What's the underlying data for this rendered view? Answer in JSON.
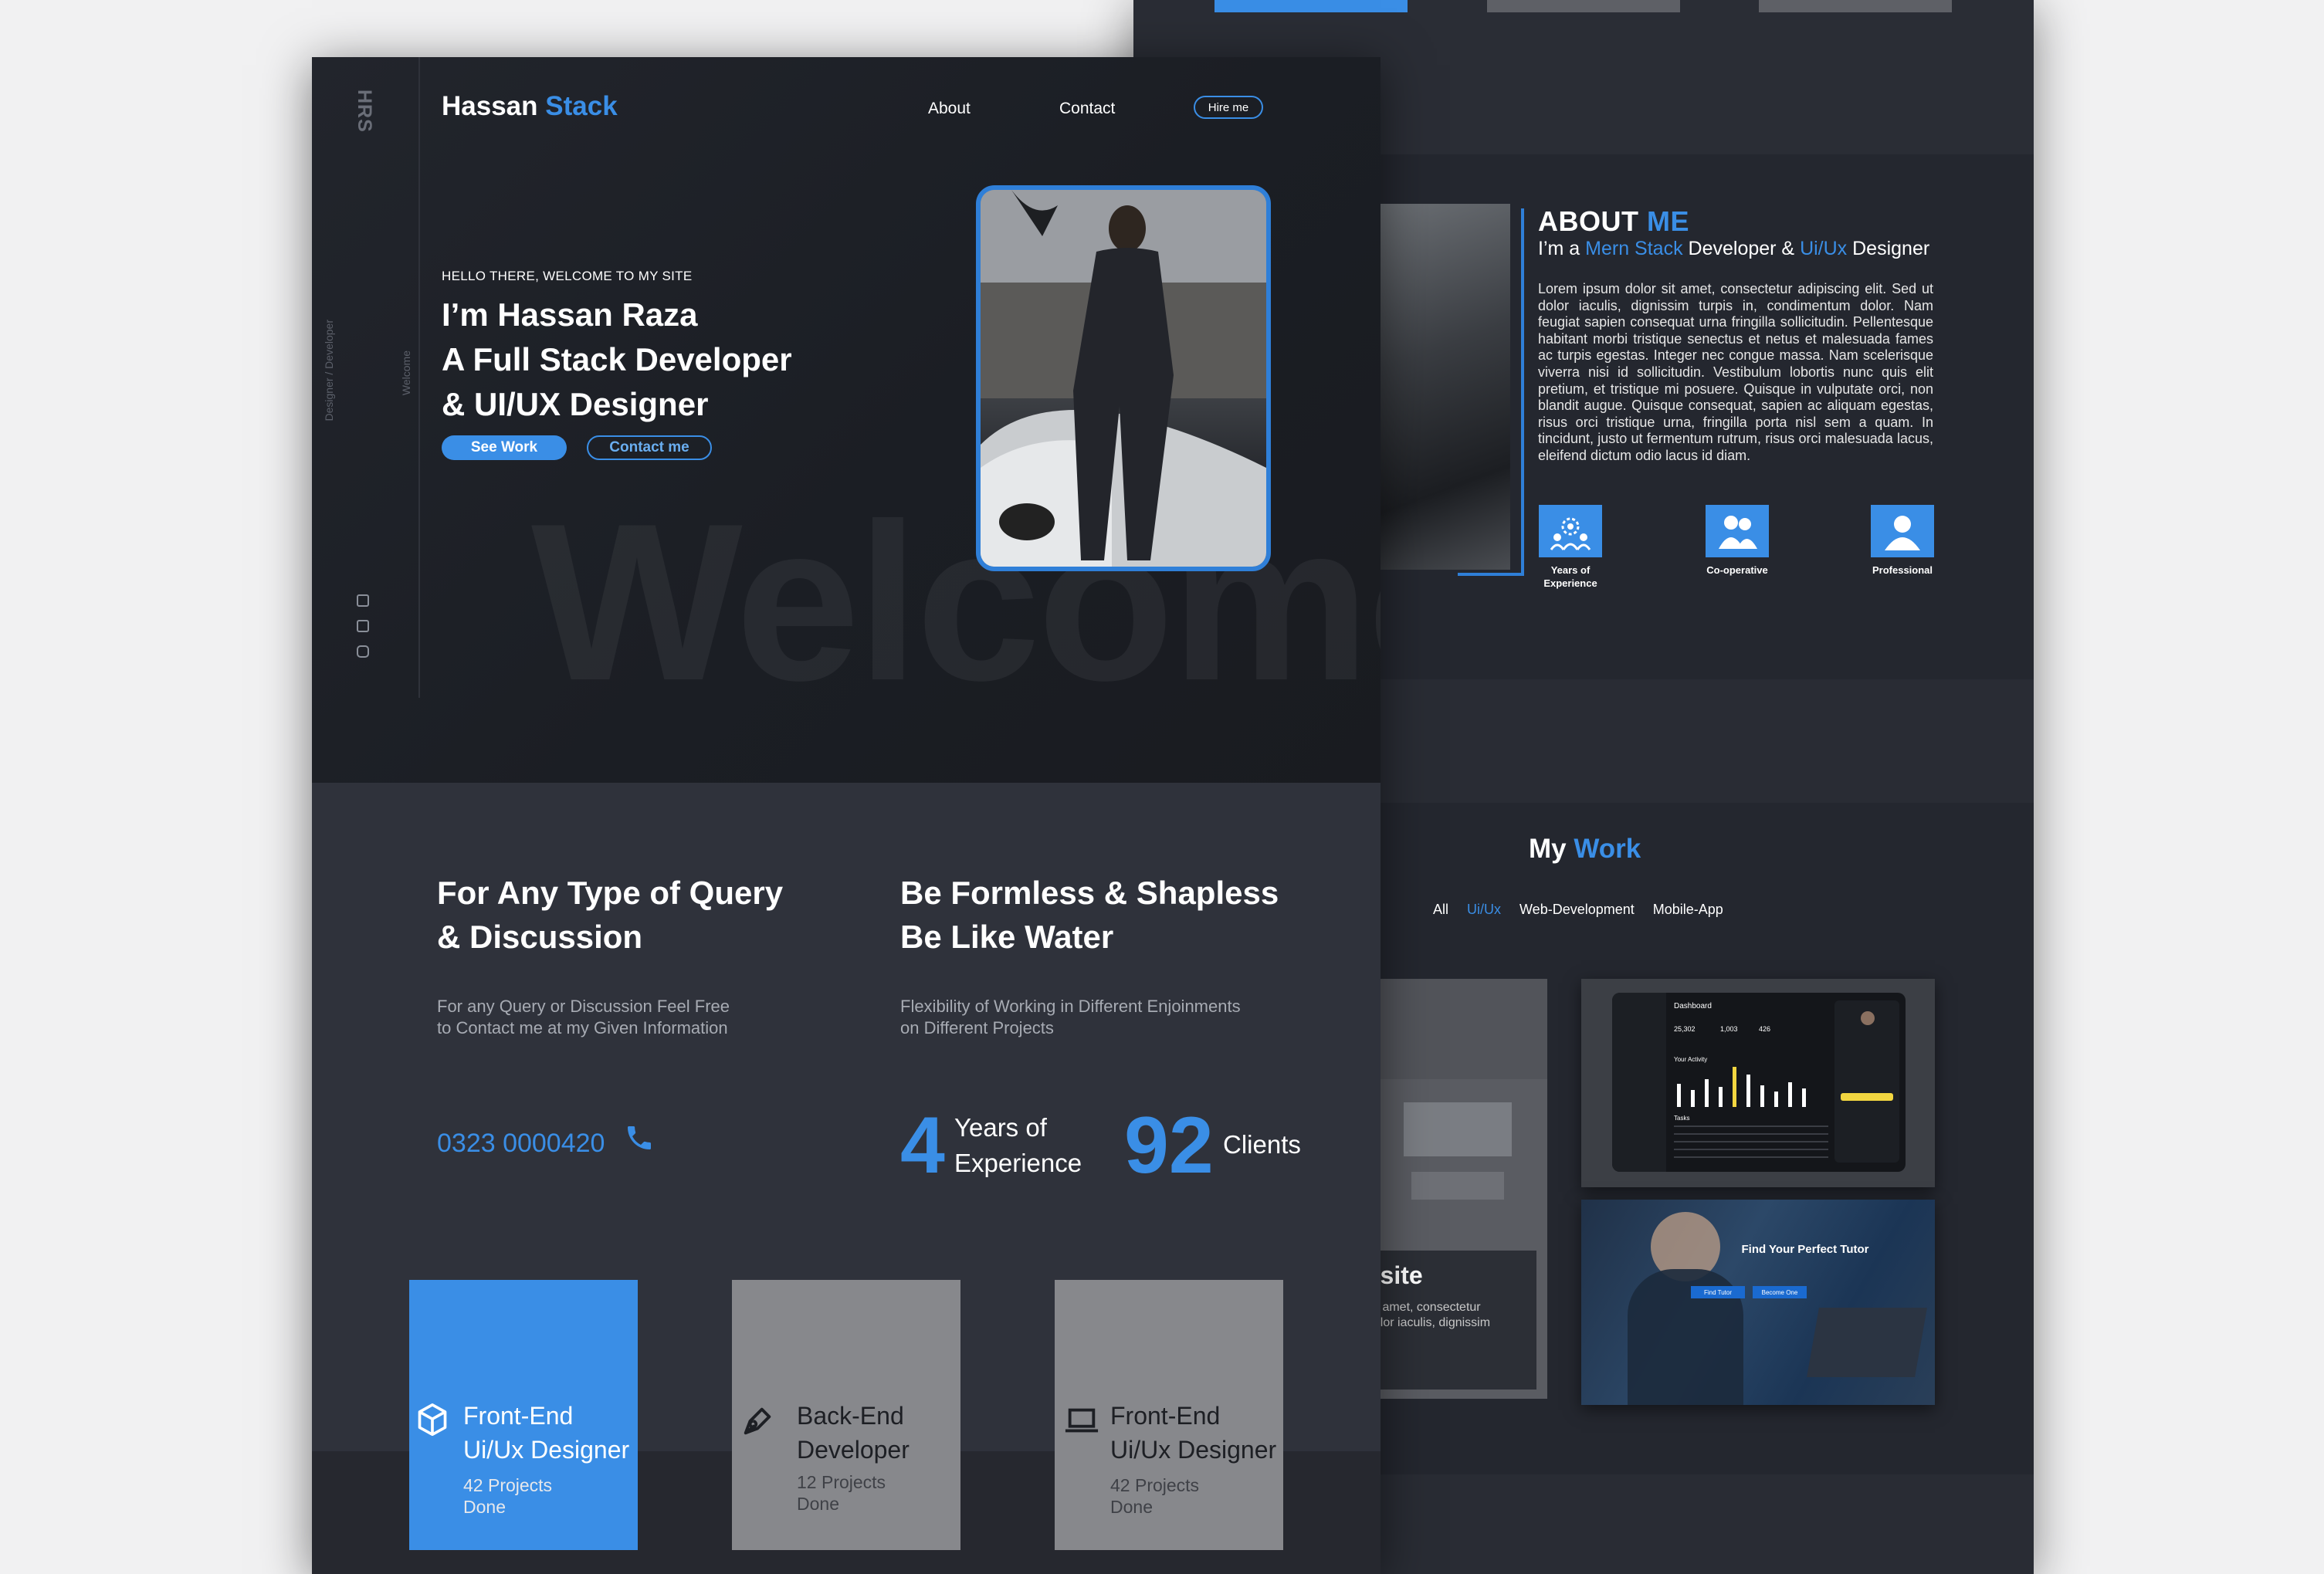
{
  "colors": {
    "accent": "#3a8ee6",
    "bg_dark": "#1d2026",
    "bg_section": "#2f323b",
    "card_grey": "#87888c"
  },
  "sidebar": {
    "logo": "HRS",
    "vertical_role": "Designer / Developer",
    "vertical_welcome": "Welcome",
    "social_icons": [
      "linkedin-icon",
      "facebook-icon",
      "instagram-icon"
    ]
  },
  "header": {
    "brand_first": "Hassan",
    "brand_second": "Stack",
    "nav": [
      "About",
      "Contact"
    ],
    "hire_label": "Hire me"
  },
  "hero": {
    "greeting": "HELLO THERE, WELCOME TO MY SITE",
    "line1": "I’m Hassan Raza",
    "line2": "A Full Stack Developer",
    "line3": "& UI/UX Designer",
    "btn_primary": "See Work",
    "btn_secondary": "Contact me",
    "bg_word": "Welcome"
  },
  "query": {
    "title_line1": "For Any Type of Query",
    "title_line2": "& Discussion",
    "desc_line1": "For any Query or Discussion Feel Free",
    "desc_line2": "to Contact me at my Given Information",
    "phone": "0323 0000420"
  },
  "formless": {
    "title_line1": "Be Formless & Shapless",
    "title_line2": "Be Like Water",
    "desc_line1": "Flexibility of Working in Different Enjoinments",
    "desc_line2": "on Different Projects",
    "stat1_num": "4",
    "stat1_label_line1": "Years of",
    "stat1_label_line2": "Experience",
    "stat2_num": "92",
    "stat2_label": "Clients"
  },
  "services": [
    {
      "title_line1": "Front-End",
      "title_line2": "Ui/Ux Designer",
      "sub_line1": "42 Projects",
      "sub_line2": "Done",
      "icon": "cube-icon"
    },
    {
      "title_line1": "Back-End",
      "title_line2": "Developer",
      "sub_line1": "12 Projects",
      "sub_line2": "Done",
      "icon": "pen-icon"
    },
    {
      "title_line1": "Front-End",
      "title_line2": "Ui/Ux Designer",
      "sub_line1": "42 Projects",
      "sub_line2": "Done",
      "icon": "laptop-icon"
    }
  ],
  "about": {
    "title_first": "ABOUT",
    "title_second": "ME",
    "sub_prefix": "I’m a",
    "sub_role1": "Mern Stack",
    "sub_mid": "Developer &",
    "sub_role2": "Ui/Ux",
    "sub_suffix": "Designer",
    "paragraph": "Lorem ipsum dolor sit amet, consectetur adipiscing elit. Sed ut dolor iaculis, dignissim turpis in, condimentum dolor. Nam feugiat sapien consequat urna fringilla sollicitudin. Pellentesque habitant morbi tristique senectus et netus et malesuada fames ac turpis egestas. Integer nec congue massa. Nam scelerisque viverra nisi id sollicitudin. Vestibulum lobortis nunc quis elit pretium, et tristique mi posuere. Quisque in vulputate orci, non blandit augue. Quisque consequat, sapien ac aliquam egestas, risus orci tristique urna, fringilla porta nisl sem a quam. In tincidunt, justo ut fermentum rutrum, risus orci malesuada lacus, eleifend dictum odio lacus id diam.",
    "features": [
      {
        "label_line1": "Years of",
        "label_line2": "Experience",
        "icon": "team-gear-icon"
      },
      {
        "label_line1": "Co-operative",
        "label_line2": "",
        "icon": "users-icon"
      },
      {
        "label_line1": "Professional",
        "label_line2": "",
        "icon": "user-icon"
      }
    ]
  },
  "work": {
    "title_first": "My",
    "title_second": "Work",
    "filters": [
      "All",
      "Ui/Ux",
      "Web-Development",
      "Mobile-App"
    ],
    "active_filter": "Ui/Ux",
    "card_partial_title": "osite",
    "card_partial_text_line1": "sit amet, consectetur",
    "card_partial_text_line2": "dolor iaculis, dignissim",
    "dashboard_title": "Dashboard",
    "dashboard_stats": [
      "25,302",
      "1,003",
      "426"
    ],
    "dashboard_activity": "Your Activity",
    "dashboard_tasks": "Tasks",
    "tutor_title": "Find Your Perfect Tutor",
    "tutor_btn1": "Find Tutor",
    "tutor_btn2": "Become One"
  }
}
